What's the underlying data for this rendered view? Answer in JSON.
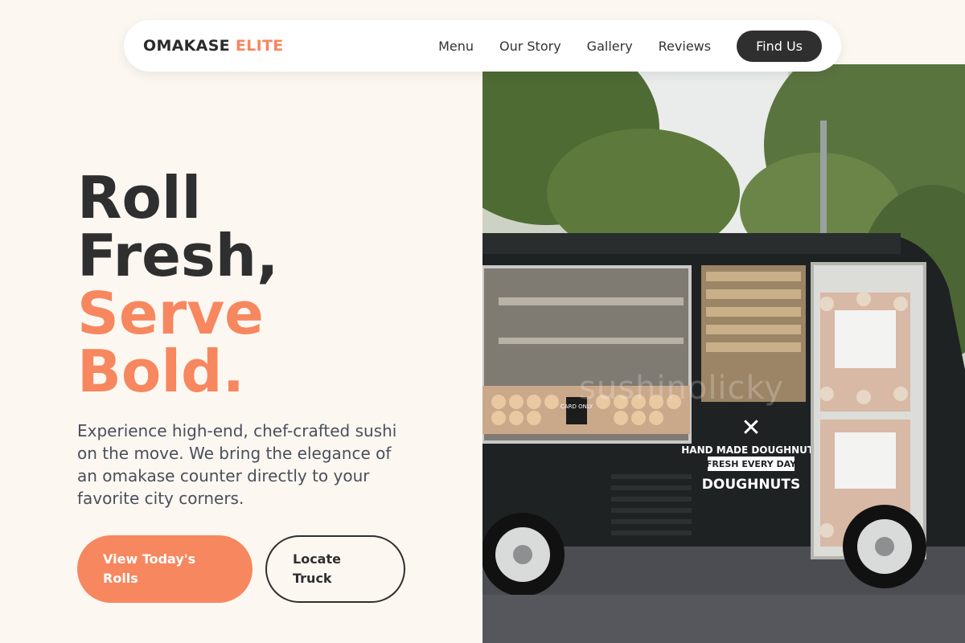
{
  "brand": {
    "name": "OMAKASE",
    "accent": "ELITE"
  },
  "nav": {
    "links": [
      "Menu",
      "Our Story",
      "Gallery",
      "Reviews"
    ],
    "cta": "Find Us"
  },
  "hero": {
    "headline_line1": "Roll",
    "headline_line2": "Fresh,",
    "headline_line3": "Serve",
    "headline_line4": "Bold.",
    "description": "Experience high-end, chef-crafted sushi on the move. We bring the elegance of an omakase counter directly to your favorite city corners.",
    "primary_button": "View Today's Rolls",
    "secondary_button": "Locate Truck"
  },
  "image": {
    "sign_line1": "HAND MADE DOUGHNUTS",
    "sign_line2": "FRESH EVERY DAY",
    "sign_line3": "DOUGHNUTS",
    "card_label": "CARD ONLY",
    "watermark": "sushinolicky"
  },
  "colors": {
    "accent": "#f7875e",
    "dark": "#2f2f2f",
    "background": "#fdf7f2"
  }
}
